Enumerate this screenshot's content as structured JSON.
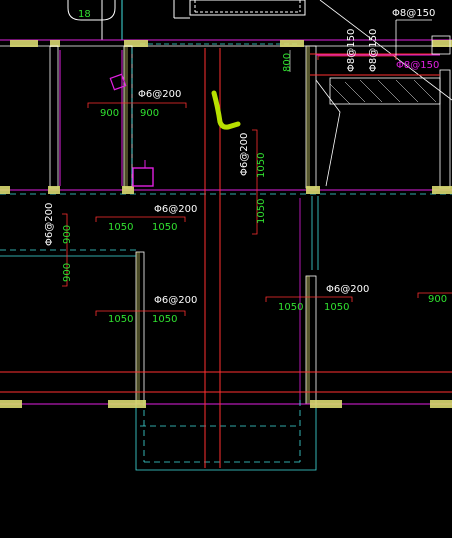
{
  "colors": {
    "background": "#000000",
    "wall": "#ffffff",
    "hatch": "#d8d870",
    "beam": "#ff3030",
    "magenta": "#e020e0",
    "cyan": "#40e0e0",
    "green": "#30e030",
    "white_text": "#ffffff",
    "markup": "#b8e000"
  },
  "rebar_labels": {
    "top_left_circle": "18",
    "top_right_spec": "Φ8@150",
    "vertical_spec_1": "Φ8@150",
    "vertical_spec_2": "Φ8@150",
    "magenta_spec": "Φ8@150",
    "dim_800": "800",
    "room1_spec": "Φ6@200",
    "room1_dim_left": "900",
    "room1_dim_right": "900",
    "room2_spec_vertical": "Φ6@200",
    "room2_dim_vertical_top": "1050",
    "room2_dim_vertical_bottom": "1050",
    "room3_spec": "Φ6@200",
    "room3_dim_left": "1050",
    "room3_dim_right": "1050",
    "room4_spec_vertical": "Φ6@200",
    "room4_dim_vertical_top": "900",
    "room4_dim_vertical_bottom": "900",
    "room5_spec": "Φ6@200",
    "room5_dim_left": "1050",
    "room5_dim_right": "1050",
    "room6_spec": "Φ6@200",
    "room6_dim_left": "1050",
    "room6_dim_right": "1050",
    "right_dim": "900"
  }
}
